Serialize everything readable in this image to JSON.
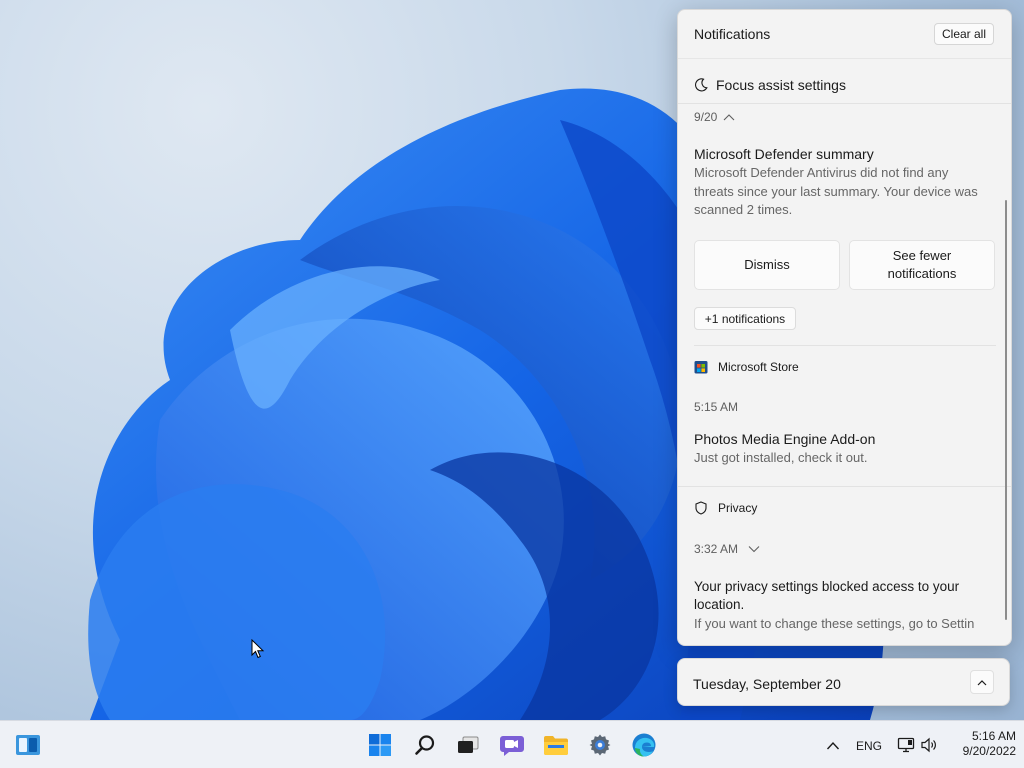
{
  "notifications_panel": {
    "title": "Notifications",
    "clear_all_label": "Clear all",
    "focus_assist_label": "Focus assist settings",
    "date_group": "9/20",
    "defender": {
      "title": "Microsoft Defender summary",
      "body_lines": [
        "Microsoft Defender Antivirus did not find any",
        "threats since your last summary. Your device was",
        "scanned 2 times."
      ],
      "dismiss_label": "Dismiss",
      "see_fewer_lines": [
        "See fewer",
        "notifications"
      ],
      "more_label": "+1 notifications"
    },
    "store": {
      "app_name": "Microsoft Store",
      "time": "5:15 AM",
      "title": "Photos Media Engine Add-on",
      "body": "Just got installed, check it out."
    },
    "privacy": {
      "app_name": "Privacy",
      "time": "3:32 AM",
      "title_lines": [
        "Your privacy settings blocked access to your",
        "location."
      ],
      "body": "If you want to change these settings, go to Settin"
    }
  },
  "calendar": {
    "date_label": "Tuesday, September 20"
  },
  "taskbar": {
    "pinned": [
      {
        "name": "start",
        "icon": "windows-logo-icon"
      },
      {
        "name": "search",
        "icon": "search-icon"
      },
      {
        "name": "task-view",
        "icon": "task-view-icon"
      },
      {
        "name": "chat",
        "icon": "chat-icon"
      },
      {
        "name": "file-explorer",
        "icon": "folder-icon"
      },
      {
        "name": "settings",
        "icon": "gear-icon"
      },
      {
        "name": "edge",
        "icon": "edge-icon"
      }
    ],
    "language": "ENG",
    "time": "5:16 AM",
    "date": "9/20/2022"
  },
  "colors": {
    "accent": "#0067c0",
    "panel_bg": "#f3f3f3",
    "taskbar_bg": "#eef1f6"
  }
}
